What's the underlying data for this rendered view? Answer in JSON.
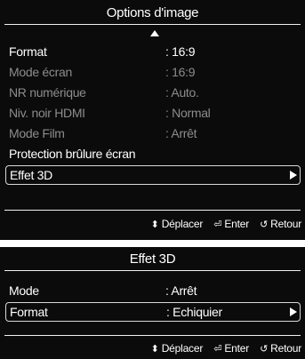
{
  "picture_options": {
    "title": "Options d'image",
    "rows": [
      {
        "label": "Format",
        "value": ": 16:9"
      },
      {
        "label": "Mode écran",
        "value": ": 16:9"
      },
      {
        "label": "NR numérique",
        "value": ": Auto."
      },
      {
        "label": "Niv. noir HDMI",
        "value": ": Normal"
      },
      {
        "label": "Mode Film",
        "value": ": Arrêt"
      },
      {
        "label": "Protection brûlure écran",
        "value": ""
      },
      {
        "label": "Effet 3D",
        "value": ""
      }
    ],
    "footer": {
      "move": "Déplacer",
      "enter": "Enter",
      "back": "Retour"
    }
  },
  "effet_3d": {
    "title": "Effet 3D",
    "rows": [
      {
        "label": "Mode",
        "value": ": Arrêt"
      },
      {
        "label": "Format",
        "value": ": Echiquier"
      }
    ],
    "footer": {
      "move": "Déplacer",
      "enter": "Enter",
      "back": "Retour"
    }
  },
  "icons": {
    "scroll_up": "triangle-up-icon",
    "submenu": "triangle-right-icon",
    "move": "up-down-arrows-icon",
    "enter": "enter-icon",
    "back": "return-icon"
  },
  "colors": {
    "panel_bg": "#0b0b0b",
    "text": "#ffffff",
    "dimmed_text": "#8c8c8c",
    "selection_border": "#d8d8d8"
  }
}
